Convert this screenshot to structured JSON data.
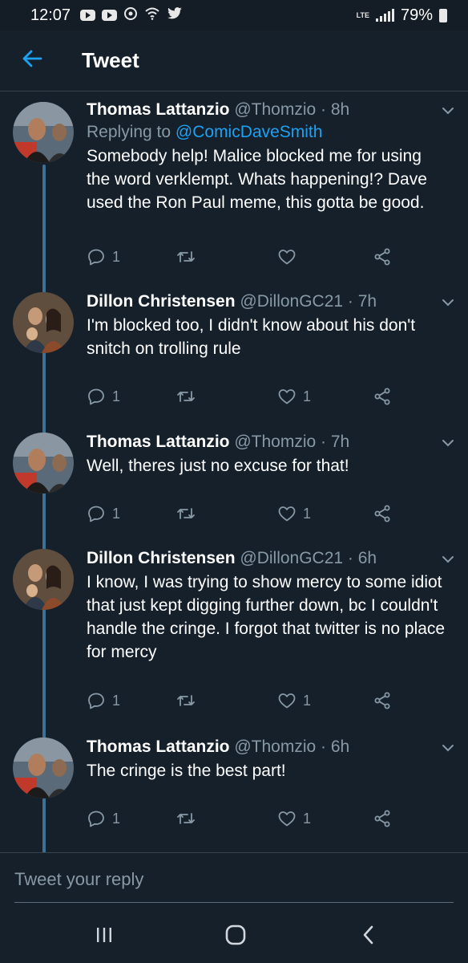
{
  "status_bar": {
    "time": "12:07",
    "network": "LTE",
    "battery": "79%",
    "icons": [
      "youtube-icon",
      "youtube-icon",
      "sync-icon",
      "wifi-icon",
      "twitter-bird-icon"
    ]
  },
  "header": {
    "title": "Tweet",
    "back_icon": "arrow-left-icon"
  },
  "colors": {
    "background": "#15202b",
    "accent": "#1da1f2",
    "secondary_text": "#8899a6",
    "thread_line": "#3e6f95"
  },
  "tweets": [
    {
      "name": "Thomas Lattanzio",
      "handle": "@Thomzio",
      "time": "· 8h",
      "replying_prefix": "Replying to ",
      "replying_to": "@ComicDaveSmith",
      "text": "Somebody help! Malice blocked me for using the word verklempt. Whats happening!? Dave used the Ron Paul meme, this gotta be good.",
      "reply_count": "1",
      "retweet_count": "",
      "like_count": ""
    },
    {
      "name": "Dillon Christensen",
      "handle": "@DillonGC21",
      "time": "· 7h",
      "text": "I'm blocked too, I didn't know about his don't snitch on trolling rule",
      "reply_count": "1",
      "retweet_count": "",
      "like_count": "1"
    },
    {
      "name": "Thomas Lattanzio",
      "handle": "@Thomzio",
      "time": "· 7h",
      "text": "Well, theres just no excuse for that!",
      "reply_count": "1",
      "retweet_count": "",
      "like_count": "1"
    },
    {
      "name": "Dillon Christensen",
      "handle": "@DillonGC21",
      "time": "· 6h",
      "text": "I know, I was trying to show mercy to some idiot that just kept digging further down, bc I couldn't handle the cringe. I forgot that twitter is no place for mercy",
      "reply_count": "1",
      "retweet_count": "",
      "like_count": "1"
    },
    {
      "name": "Thomas Lattanzio",
      "handle": "@Thomzio",
      "time": "· 6h",
      "text": "The cringe is the best part!",
      "reply_count": "1",
      "retweet_count": "",
      "like_count": "1"
    }
  ],
  "reply_box": {
    "placeholder": "Tweet your reply"
  },
  "nav": {
    "recents_icon": "recents-icon",
    "home_icon": "home-icon",
    "back_icon": "back-icon"
  }
}
